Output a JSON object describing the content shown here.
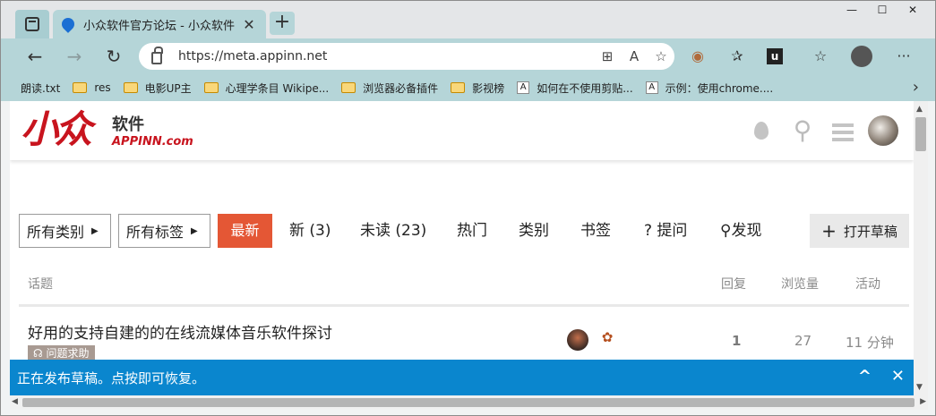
{
  "browser": {
    "tab_title": "小众软件官方论坛 - 小众软件",
    "tab_close": "✕",
    "new_tab": "+",
    "window_controls": {
      "minimize": "—",
      "maximize": "☐",
      "close": "✕"
    },
    "url": "https://meta.appinn.net",
    "nav": {
      "back": "←",
      "forward": "→",
      "refresh": "↻"
    },
    "address_icons": [
      "apps-icon",
      "read-aloud-icon",
      "favorites-add-icon"
    ],
    "toolbar_icons": [
      "extension-icon",
      "favorites-icon",
      "extension-u-icon",
      "collections-icon",
      "profile-avatar",
      "more-icon"
    ],
    "more": "···",
    "bookmarks": [
      {
        "label": "朗读.txt",
        "icon": "page"
      },
      {
        "label": "res",
        "icon": "folder"
      },
      {
        "label": "电影UP主",
        "icon": "folder"
      },
      {
        "label": "心理学条目 Wikipe...",
        "icon": "folder"
      },
      {
        "label": "浏览器必备插件",
        "icon": "folder"
      },
      {
        "label": "影视榜",
        "icon": "folder"
      },
      {
        "label": "如何在不使用剪贴...",
        "icon": "a"
      },
      {
        "label": "示例：使用chrome....",
        "icon": "a"
      }
    ],
    "bookmarks_more": "›"
  },
  "site": {
    "logo_mark": "小众",
    "logo_cn": "软件",
    "logo_en": "APPINN.com",
    "header_icons": [
      "drop-icon",
      "search-icon",
      "menu-icon",
      "user-avatar"
    ]
  },
  "filters": {
    "categories": "所有类别",
    "tags": "所有标签",
    "latest": "最新",
    "new": "新 (3)",
    "unread": "未读 (23)",
    "top": "热门",
    "category": "类别",
    "bookmarks": "书签",
    "ask": "? 提问",
    "discover": "发现",
    "draft_button": "打开草稿"
  },
  "table": {
    "headers": {
      "topic": "话题",
      "replies": "回复",
      "views": "浏览量",
      "activity": "活动"
    },
    "rows": [
      {
        "title": "好用的支持自建的的在线流媒体音乐软件探讨",
        "category": "问题求助",
        "replies": "1",
        "views": "27",
        "activity": "11 分钟"
      }
    ]
  },
  "draft_bar": {
    "message": "正在发布草稿。点按即可恢复。",
    "expand": "^",
    "close": "✕"
  },
  "colors": {
    "accent": "#e45735",
    "draft_bar": "#0a86ce",
    "browser_toolbar": "#b5d5d8",
    "logo_red": "#c8141e"
  }
}
